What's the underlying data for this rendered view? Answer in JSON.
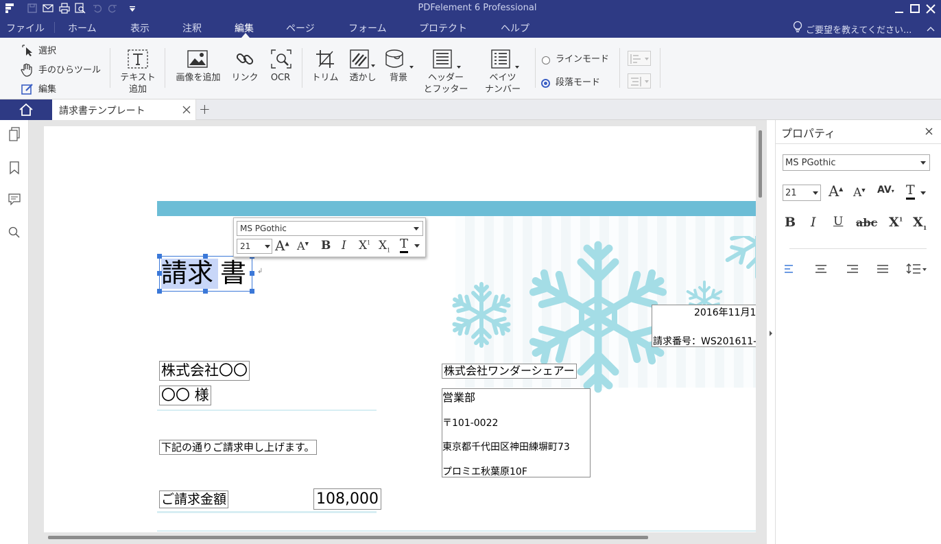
{
  "app": {
    "title": "PDFelement 6 Professional"
  },
  "menu": {
    "items": [
      "ファイル",
      "ホーム",
      "表示",
      "注釈",
      "編集",
      "ページ",
      "フォーム",
      "プロテクト",
      "ヘルプ"
    ],
    "active": "編集",
    "request": "ご要望を教えてください..."
  },
  "ribbon": {
    "select": "選択",
    "hand_tool": "手のひらツール",
    "edit": "編集",
    "add_text_1": "テキスト",
    "add_text_2": "追加",
    "add_image": "画像を追加",
    "link": "リンク",
    "ocr": "OCR",
    "trim": "トリム",
    "watermark": "透かし",
    "background": "背景",
    "header_footer_1": "ヘッダー",
    "header_footer_2": "とフッター",
    "bates_1": "ベイツ",
    "bates_2": "ナンバー",
    "line_mode": "ラインモード",
    "paragraph_mode": "段落モード",
    "mode_selected": "paragraph"
  },
  "tabs": {
    "doc_title": "請求書テンプレート",
    "new_tab": "+"
  },
  "floating_toolbar": {
    "font": "MS PGothic",
    "size": "21"
  },
  "document": {
    "title_selected": "請求",
    "title_rest": "書",
    "company": "株式会社〇〇",
    "recipient": "〇〇 様",
    "message": "下記の通りご請求申し上げます。",
    "amount_label": "ご請求金額",
    "amount_value": "108,000",
    "date": "2016年11月1",
    "invoice_no": "請求番号：WS201611-",
    "sender_company": "株式会社ワンダーシェアー",
    "dept": "営業部",
    "postal": "〒101-0022",
    "address1": "東京都千代田区神田練塀町73",
    "address2": "プロミエ秋葉原10F"
  },
  "properties": {
    "title": "プロパティ",
    "font": "MS PGothic",
    "size": "21"
  },
  "colors": {
    "titlebar": "#2e3a84",
    "accent": "#3b78d8",
    "band": "#6cbdd6",
    "snowflake": "#a4dde6"
  }
}
